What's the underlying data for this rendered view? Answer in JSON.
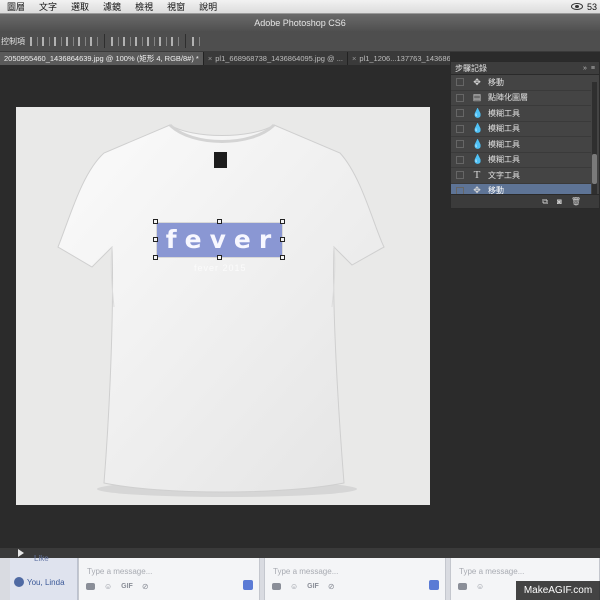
{
  "menubar": {
    "items": [
      "圖層",
      "文字",
      "選取",
      "濾鏡",
      "檢視",
      "視窗",
      "說明"
    ],
    "right_text": "53"
  },
  "app": {
    "title": "Adobe Photoshop CS6"
  },
  "options_bar": {
    "label": "控制項"
  },
  "tabs": [
    {
      "label": "2050955460_1436864639.jpg @ 100% (矩形 4, RGB/8#) *",
      "active": true
    },
    {
      "label": "pl1_668968738_1436864095.jpg @ ...",
      "active": false
    },
    {
      "label": "pl1_1206...137763_1436864825.jpg",
      "active": false
    }
  ],
  "canvas": {
    "shirt_text": "fever",
    "sub_text": "fever 2015",
    "selection_color": "#8a97d3"
  },
  "history_panel": {
    "title": "步驟記錄",
    "items": [
      {
        "label": "移動",
        "icon": "move-icon",
        "active": false
      },
      {
        "label": "點陣化圖層",
        "icon": "layer-icon",
        "active": false
      },
      {
        "label": "模糊工具",
        "icon": "blur-drop-icon",
        "active": false
      },
      {
        "label": "模糊工具",
        "icon": "blur-drop-icon",
        "active": false
      },
      {
        "label": "模糊工具",
        "icon": "blur-drop-icon",
        "active": false
      },
      {
        "label": "模糊工具",
        "icon": "blur-drop-icon",
        "active": false
      },
      {
        "label": "文字工具",
        "icon": "type-icon",
        "active": false
      },
      {
        "label": "移動",
        "icon": "move-icon",
        "active": true
      }
    ],
    "active_color": "#5e7496"
  },
  "chat": {
    "like_label": "Like",
    "you_label": "You, Linda",
    "boxes": [
      {
        "placeholder": "Type a message..."
      },
      {
        "placeholder": "Type a message..."
      },
      {
        "placeholder": "Type a message..."
      }
    ],
    "gif_label": "GIF"
  },
  "watermark": "MakeAGIF.com"
}
